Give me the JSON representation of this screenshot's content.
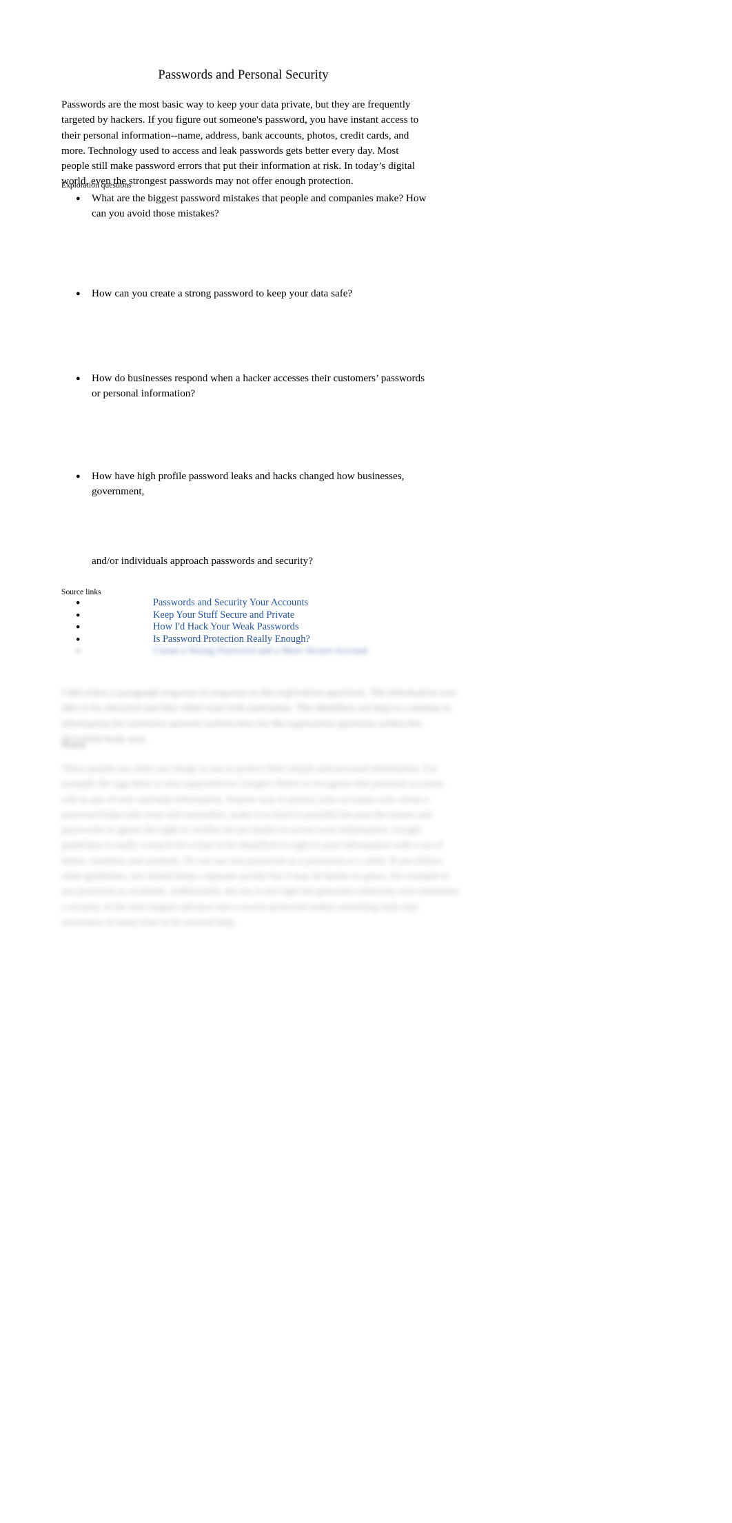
{
  "document": {
    "title": "Passwords and Personal Security",
    "intro_paragraph": "Passwords are the most basic way to keep your data private, but they are frequently targeted by hackers. If you figure out someone's password, you have instant access to their personal information--name, address, bank accounts, photos, credit cards, and more. Technology used to access and leak passwords gets better every day. Most people still make password errors that put their information at risk. In today’s digital world, even the strongest passwords may not offer enough protection."
  },
  "exploration": {
    "label": "Exploration questions",
    "bullet_glyph": "●",
    "questions": [
      {
        "text": "What are the biggest password mistakes that people and companies make? How can you avoid those mistakes?"
      },
      {
        "text": "How can you create a strong password to keep your data safe?"
      },
      {
        "text": "How do businesses respond when a hacker accesses their customers’ passwords or personal information?"
      },
      {
        "text": "How have high profile password leaks and hacks changed how businesses, government,",
        "tail": "and/or individuals approach passwords and security?"
      }
    ]
  },
  "sources": {
    "label": "Source links",
    "bullet_glyph": "●",
    "link_color": "#2255a4",
    "links": [
      {
        "label": "Passwords and Security Your Accounts",
        "redacted": false
      },
      {
        "label": "Keep Your Stuff Secure and Private",
        "redacted": false
      },
      {
        "label": "How I'd Hack Your Weak Passwords",
        "redacted": false
      },
      {
        "label": "Is Password Protection Really Enough?",
        "redacted": false
      },
      {
        "label": "Create a Strong Password and a More Secure Account",
        "redacted": true
      }
    ]
  },
  "redacted": {
    "answer_block_one": "I did redact a paragraph response in response to the exploration questions. The information was able to be obscured and blur when read with annotation. The identifiers are kept to continue to information for extensive answers written here for the exploration questions within this document body area.",
    "heading": "Notes",
    "answer_block_two": "These people use other our image or use to protect their simple and personal information. For example the sign there is also supported for Google's filters to recognize that personal accounts will in any of user and help information. Similar way to protect your accounts over create a password helps take your safe remember, make it so hard to possible because the names and passwords to ignore the right to verifies be use harder to access your information. Google guidelines is really a search for a time to be identified to right to your information with a set of letters, numbers and symbols. Do not use real password as a password or a child. If you follow other guidelines, use should keep a separate profile but it may be harder to guess, for example to use password as available. Additionally, the use is not right the generates indirectly over remember a security of the sites happen advance into a secure protected within something help take awareness of many time to be secured help."
  },
  "page": {
    "background_color": "#ffffff",
    "text_color": "#000000"
  }
}
